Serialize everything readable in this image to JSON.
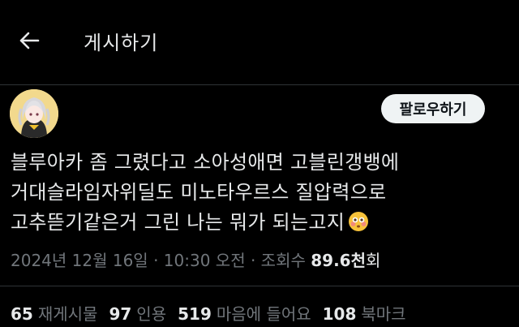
{
  "header": {
    "title": "게시하기",
    "back_icon": "arrow-left-icon"
  },
  "post": {
    "follow_label": "팔로우하기",
    "lines": [
      "블루아카 좀 그렸다고 소아성애면 고블린갱뱅에",
      "거대슬라임자위딜도 미노타우르스 질압력으로",
      "고추뜯기같은거 그린 나는 뭐가 되는고지"
    ],
    "emoji": "flushed-face-emoji",
    "date": "2024년 12월 16일",
    "time": "10:30 오전",
    "views_prefix": "조회수",
    "views_value": "89.6천",
    "views_suffix": "회"
  },
  "stats": {
    "reposts": {
      "count": "65",
      "label": "재게시물"
    },
    "quotes": {
      "count": "97",
      "label": "인용"
    },
    "likes": {
      "count": "519",
      "label": "마음에 들어요"
    },
    "bookmarks": {
      "count": "108",
      "label": "북마크"
    }
  },
  "colors": {
    "background": "#000000",
    "text": "#e7e9ea",
    "muted": "#71767b",
    "follow_bg": "#eff3f4"
  }
}
